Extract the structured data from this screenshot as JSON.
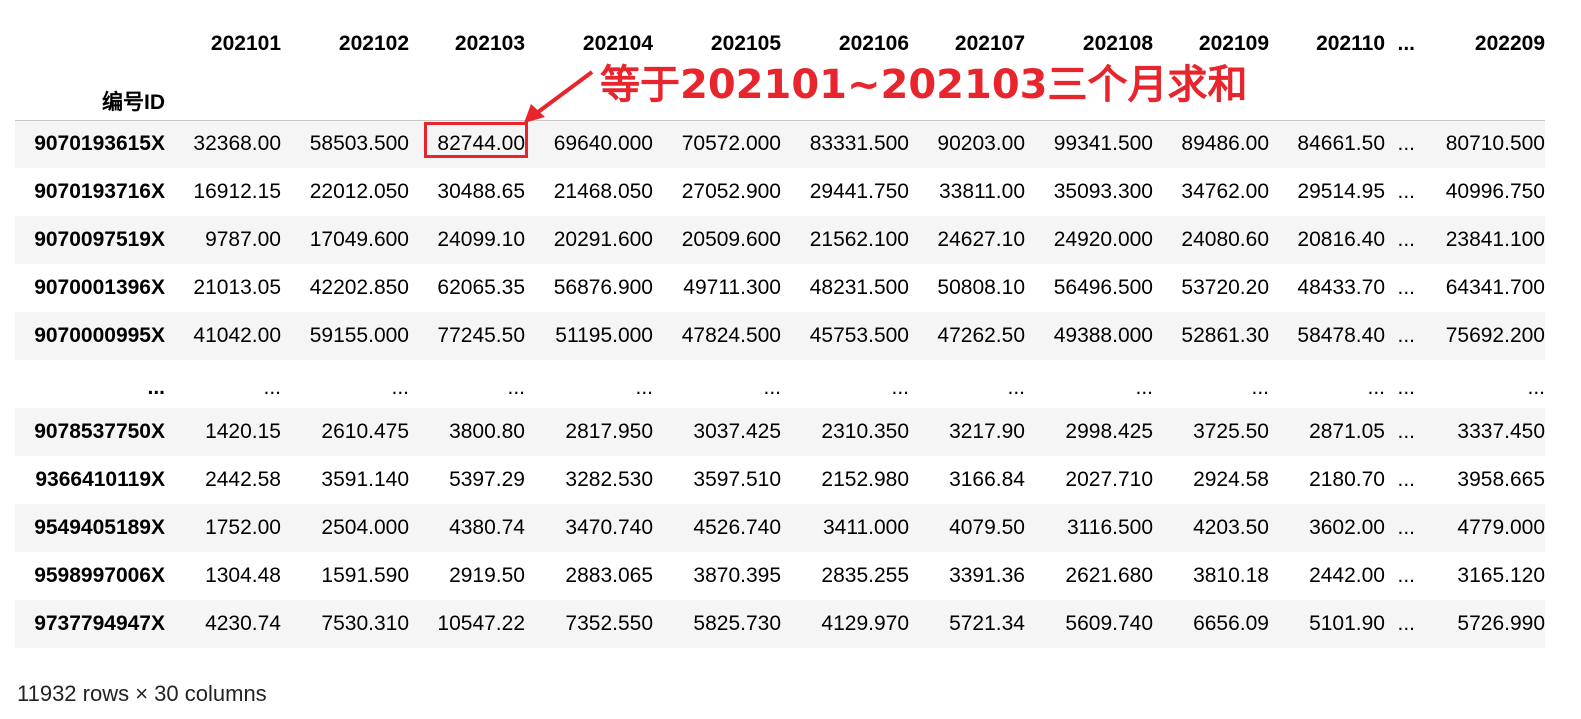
{
  "table": {
    "index_name": "编号ID",
    "columns": [
      "202101",
      "202102",
      "202103",
      "202104",
      "202105",
      "202106",
      "202107",
      "202108",
      "202109",
      "202110",
      "...",
      "202209"
    ],
    "rows": [
      {
        "id": "9070193615X",
        "cells": [
          "32368.00",
          "58503.500",
          "82744.00",
          "69640.000",
          "70572.000",
          "83331.500",
          "90203.00",
          "99341.500",
          "89486.00",
          "84661.50",
          "...",
          "80710.500"
        ]
      },
      {
        "id": "9070193716X",
        "cells": [
          "16912.15",
          "22012.050",
          "30488.65",
          "21468.050",
          "27052.900",
          "29441.750",
          "33811.00",
          "35093.300",
          "34762.00",
          "29514.95",
          "...",
          "40996.750"
        ]
      },
      {
        "id": "9070097519X",
        "cells": [
          "9787.00",
          "17049.600",
          "24099.10",
          "20291.600",
          "20509.600",
          "21562.100",
          "24627.10",
          "24920.000",
          "24080.60",
          "20816.40",
          "...",
          "23841.100"
        ]
      },
      {
        "id": "9070001396X",
        "cells": [
          "21013.05",
          "42202.850",
          "62065.35",
          "56876.900",
          "49711.300",
          "48231.500",
          "50808.10",
          "56496.500",
          "53720.20",
          "48433.70",
          "...",
          "64341.700"
        ]
      },
      {
        "id": "9070000995X",
        "cells": [
          "41042.00",
          "59155.000",
          "77245.50",
          "51195.000",
          "47824.500",
          "45753.500",
          "47262.50",
          "49388.000",
          "52861.30",
          "58478.40",
          "...",
          "75692.200"
        ]
      },
      {
        "id": "...",
        "cells": [
          "...",
          "...",
          "...",
          "...",
          "...",
          "...",
          "...",
          "...",
          "...",
          "...",
          "...",
          "..."
        ]
      },
      {
        "id": "9078537750X",
        "cells": [
          "1420.15",
          "2610.475",
          "3800.80",
          "2817.950",
          "3037.425",
          "2310.350",
          "3217.90",
          "2998.425",
          "3725.50",
          "2871.05",
          "...",
          "3337.450"
        ]
      },
      {
        "id": "9366410119X",
        "cells": [
          "2442.58",
          "3591.140",
          "5397.29",
          "3282.530",
          "3597.510",
          "2152.980",
          "3166.84",
          "2027.710",
          "2924.58",
          "2180.70",
          "...",
          "3958.665"
        ]
      },
      {
        "id": "9549405189X",
        "cells": [
          "1752.00",
          "2504.000",
          "4380.74",
          "3470.740",
          "4526.740",
          "3411.000",
          "4079.50",
          "3116.500",
          "4203.50",
          "3602.00",
          "...",
          "4779.000"
        ]
      },
      {
        "id": "9598997006X",
        "cells": [
          "1304.48",
          "1591.590",
          "2919.50",
          "2883.065",
          "3870.395",
          "2835.255",
          "3391.36",
          "2621.680",
          "3810.18",
          "2442.00",
          "...",
          "3165.120"
        ]
      },
      {
        "id": "9737794947X",
        "cells": [
          "4230.74",
          "7530.310",
          "10547.22",
          "7352.550",
          "5825.730",
          "4129.970",
          "5721.34",
          "5609.740",
          "6656.09",
          "5101.90",
          "...",
          "5726.990"
        ]
      }
    ]
  },
  "shape_text": "11932 rows × 30 columns",
  "annotation": {
    "text": "等于202101~202103三个月求和",
    "color": "#e8242c"
  },
  "colors": {
    "stripe": "#f5f5f5",
    "accent": "#e8242c"
  }
}
